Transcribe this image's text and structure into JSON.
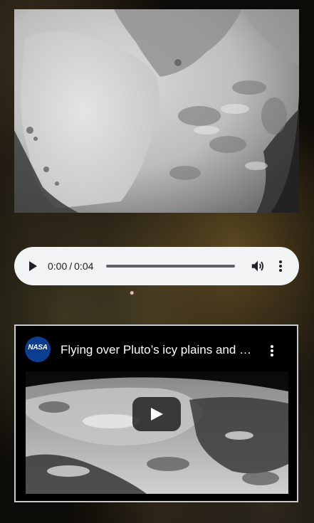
{
  "pluto_image": {
    "alt": "Pluto surface"
  },
  "audio_player": {
    "current_time": "0:00",
    "separator": "/",
    "duration": "0:04",
    "progress_fraction": 0,
    "icons": {
      "play": "play-icon",
      "volume": "volume-icon",
      "more": "more-vert-icon"
    }
  },
  "video_embed": {
    "channel_logo_text": "NASA",
    "title": "Flying over Pluto’s icy plains and mountains",
    "icons": {
      "play": "youtube-play-icon",
      "more": "more-vert-icon"
    }
  },
  "colors": {
    "player_bg": "#f1f3f4",
    "player_text": "#202124",
    "video_border": "#c9c9c9",
    "nasa_blue": "#0b3d91"
  }
}
